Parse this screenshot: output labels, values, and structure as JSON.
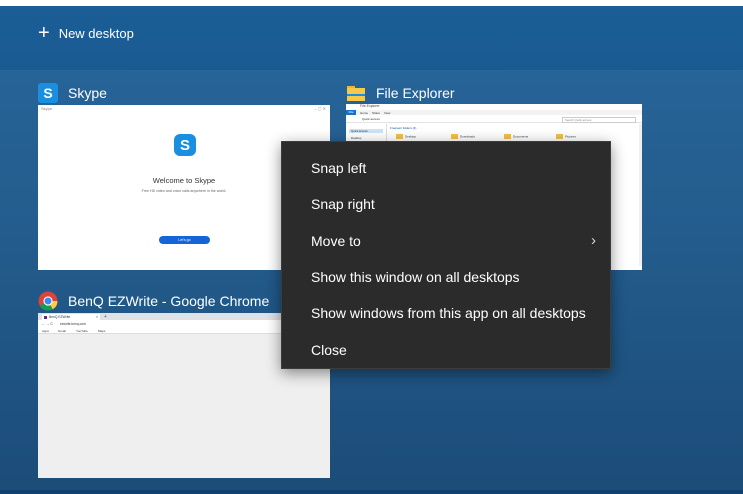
{
  "top_bar": {
    "new_desktop_label": "New desktop",
    "plus_icon": "+"
  },
  "windows": {
    "skype": {
      "title": "Skype",
      "icon_letter": "S",
      "icon_color": "#1a8fe0",
      "thumb_title": "Skype",
      "welcome": "Welcome to Skype",
      "subtitle": "Free HD video and voice calls anywhere in the world.",
      "button": "Let's go"
    },
    "file_explorer": {
      "title": "File Explorer",
      "thumb_title": "File Explorer",
      "tabs": [
        "File",
        "Home",
        "Share",
        "View"
      ],
      "address": "Quick access",
      "search_placeholder": "Search Quick access",
      "nav_quick_access": "Quick access",
      "nav_desktop": "Desktop",
      "section_title": "Frequent folders (4)",
      "folders": [
        "Desktop",
        "Downloads",
        "Documents",
        "Pictures"
      ]
    },
    "chrome": {
      "title": "BenQ EZWrite - Google Chrome",
      "tab_title": "BenQ EZWrite",
      "url": "ezwrite.benq.com",
      "bookmarks": [
        "Apps",
        "Gmail",
        "YouTube",
        "Maps"
      ]
    }
  },
  "context_menu": {
    "items": [
      {
        "label": "Snap left"
      },
      {
        "label": "Snap right"
      },
      {
        "label": "Move to",
        "chevron": "›"
      },
      {
        "label": "Show this window on all desktops"
      },
      {
        "label": "Show windows from this app on all desktops"
      },
      {
        "label": "Close"
      }
    ]
  },
  "colors": {
    "background": "#175489",
    "menu_bg": "#2b2b2b",
    "skype_blue": "#1a8fe0",
    "skype_button": "#1565d8",
    "folder_yellow": "#f1c049"
  }
}
